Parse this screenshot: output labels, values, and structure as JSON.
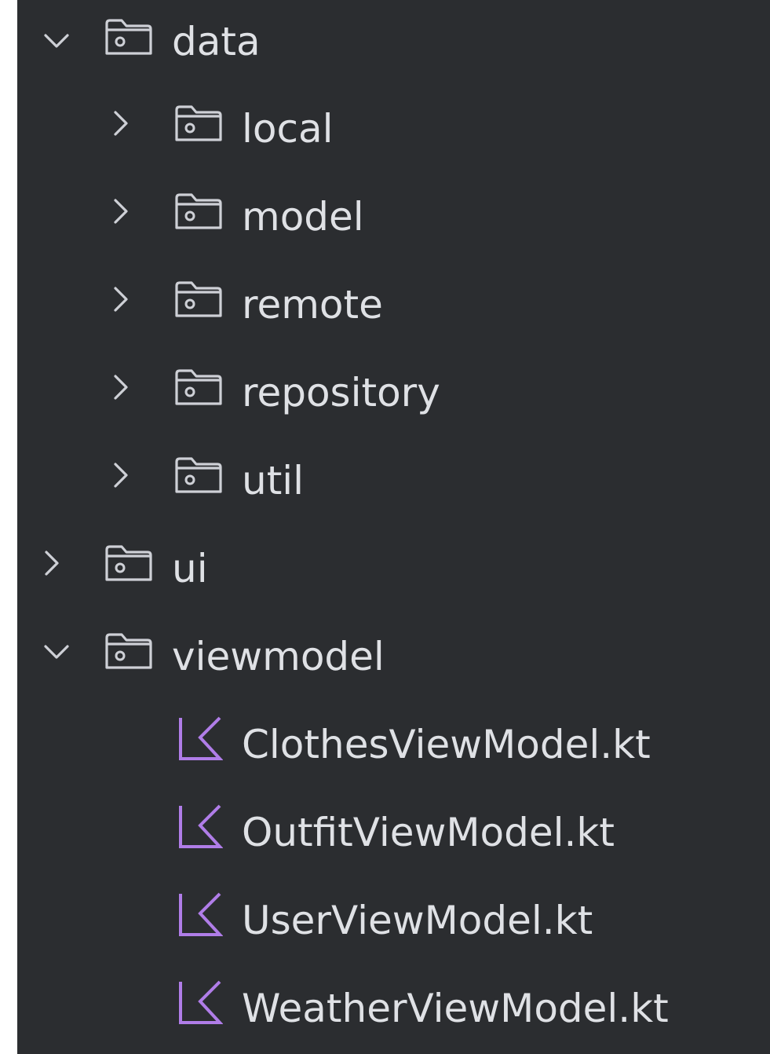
{
  "tree": {
    "items": [
      {
        "label": "data",
        "kind": "folder",
        "expanded": true
      },
      {
        "label": "local",
        "kind": "folder",
        "expanded": false
      },
      {
        "label": "model",
        "kind": "folder",
        "expanded": false
      },
      {
        "label": "remote",
        "kind": "folder",
        "expanded": false
      },
      {
        "label": "repository",
        "kind": "folder",
        "expanded": false
      },
      {
        "label": "util",
        "kind": "folder",
        "expanded": false
      },
      {
        "label": "ui",
        "kind": "folder",
        "expanded": false
      },
      {
        "label": "viewmodel",
        "kind": "folder",
        "expanded": true
      },
      {
        "label": "ClothesViewModel.kt",
        "kind": "kotlin-file"
      },
      {
        "label": "OutfitViewModel.kt",
        "kind": "kotlin-file"
      },
      {
        "label": "UserViewModel.kt",
        "kind": "kotlin-file"
      },
      {
        "label": "WeatherViewModel.kt",
        "kind": "kotlin-file"
      }
    ]
  },
  "icons": {
    "expanded": "chevron-down-icon",
    "collapsed": "chevron-right-icon",
    "folder": "package-folder-icon",
    "kotlin": "kotlin-file-icon"
  },
  "colors": {
    "background": "#2b2d30",
    "text": "#dfe1e5",
    "icon": "#ced0d6",
    "kotlin": "#b07de8"
  }
}
